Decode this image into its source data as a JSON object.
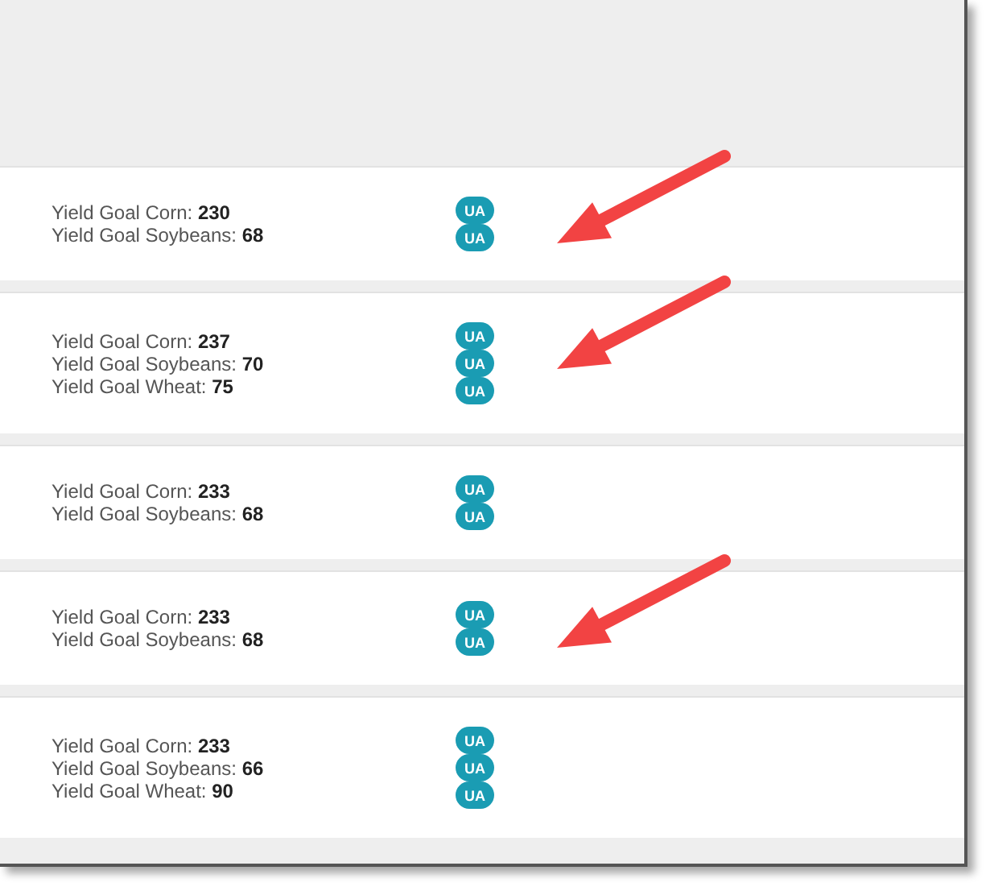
{
  "rows": [
    {
      "goals": [
        {
          "label": "Yield Goal Corn:",
          "value": "230"
        },
        {
          "label": "Yield Goal Soybeans:",
          "value": "68"
        }
      ],
      "badges": [
        "UA",
        "UA"
      ],
      "marked": true
    },
    {
      "goals": [
        {
          "label": "Yield Goal Corn:",
          "value": "237"
        },
        {
          "label": "Yield Goal Soybeans:",
          "value": "70"
        },
        {
          "label": "Yield Goal Wheat:",
          "value": "75"
        }
      ],
      "badges": [
        "UA",
        "UA",
        "UA"
      ],
      "marked": true
    },
    {
      "goals": [
        {
          "label": "Yield Goal Corn:",
          "value": "233"
        },
        {
          "label": "Yield Goal Soybeans:",
          "value": "68"
        }
      ],
      "badges": [
        "UA",
        "UA"
      ],
      "marked": false
    },
    {
      "goals": [
        {
          "label": "Yield Goal Corn:",
          "value": "233"
        },
        {
          "label": "Yield Goal Soybeans:",
          "value": "68"
        }
      ],
      "badges": [
        "UA",
        "UA"
      ],
      "marked": true
    },
    {
      "goals": [
        {
          "label": "Yield Goal Corn:",
          "value": "233"
        },
        {
          "label": "Yield Goal Soybeans:",
          "value": "66"
        },
        {
          "label": "Yield Goal Wheat:",
          "value": "90"
        }
      ],
      "badges": [
        "UA",
        "UA",
        "UA"
      ],
      "marked": false
    }
  ]
}
